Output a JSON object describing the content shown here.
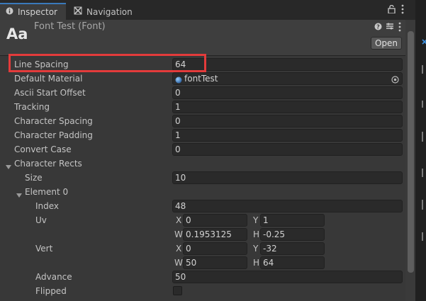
{
  "tabs": [
    {
      "label": "Inspector",
      "icon": "info-icon"
    },
    {
      "label": "Navigation",
      "icon": "navigation-icon"
    }
  ],
  "header": {
    "icon_text": "Aa",
    "title": "Font Test (Font)",
    "open_label": "Open"
  },
  "properties": {
    "line_spacing": {
      "label": "Line Spacing",
      "value": "64"
    },
    "default_material": {
      "label": "Default Material",
      "value": "fontTest"
    },
    "ascii_start_offset": {
      "label": "Ascii Start Offset",
      "value": "0"
    },
    "tracking": {
      "label": "Tracking",
      "value": "1"
    },
    "character_spacing": {
      "label": "Character Spacing",
      "value": "0"
    },
    "character_padding": {
      "label": "Character Padding",
      "value": "1"
    },
    "convert_case": {
      "label": "Convert Case",
      "value": "0"
    },
    "character_rects": {
      "label": "Character Rects"
    },
    "size": {
      "label": "Size",
      "value": "10"
    },
    "element0": {
      "label": "Element 0"
    },
    "index": {
      "label": "Index",
      "value": "48"
    },
    "uv": {
      "label": "Uv",
      "x_label": "X",
      "x": "0",
      "y_label": "Y",
      "y": "1",
      "w_label": "W",
      "w": "0.1953125",
      "h_label": "H",
      "h": "-0.25"
    },
    "vert": {
      "label": "Vert",
      "x_label": "X",
      "x": "0",
      "y_label": "Y",
      "y": "-32",
      "w_label": "W",
      "w": "50",
      "h_label": "H",
      "h": "64"
    },
    "advance": {
      "label": "Advance",
      "value": "50"
    },
    "flipped": {
      "label": "Flipped",
      "checked": false
    }
  },
  "colors": {
    "accent": "#3a79bb",
    "highlight": "#e33b3b"
  }
}
